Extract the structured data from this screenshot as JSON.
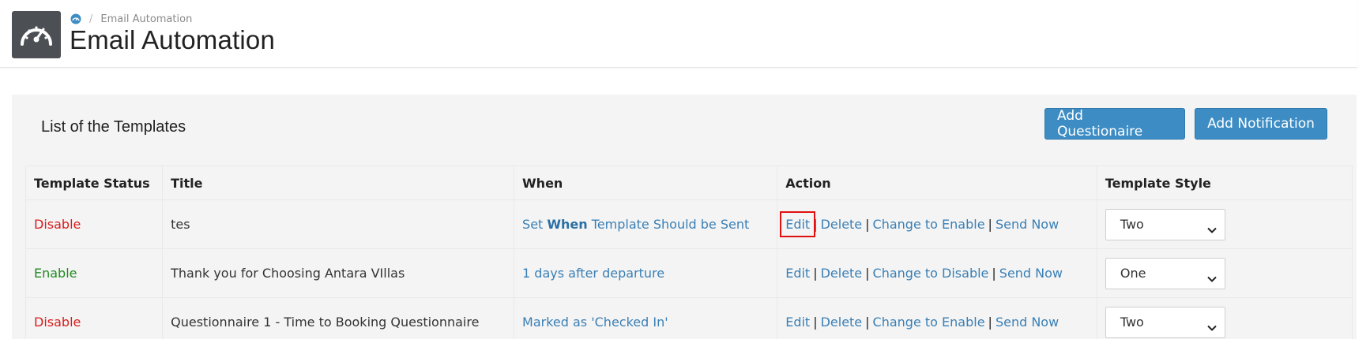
{
  "breadcrumb": {
    "current": "Email Automation",
    "separator": "/"
  },
  "page": {
    "title": "Email Automation"
  },
  "panel": {
    "title": "List of the Templates",
    "buttons": {
      "add_questionaire": "Add Questionaire",
      "add_notification": "Add Notification"
    }
  },
  "table": {
    "headers": {
      "status": "Template Status",
      "title": "Title",
      "when": "When",
      "action": "Action",
      "style": "Template Style"
    },
    "rows": [
      {
        "status": "Disable",
        "title": "tes",
        "when_prefix": "Set ",
        "when_bold": "When",
        "when_suffix": " Template Should be Sent",
        "action_edit": "Edit",
        "action_delete": "Delete",
        "action_toggle": "Change to Enable",
        "action_send": "Send Now",
        "style": "Two"
      },
      {
        "status": "Enable",
        "title": "Thank you for Choosing Antara VIllas",
        "when": "1 days after departure",
        "action_edit": "Edit",
        "action_delete": "Delete",
        "action_toggle": "Change to Disable",
        "action_send": "Send Now",
        "style": "One"
      },
      {
        "status": "Disable",
        "title": "Questionnaire 1 - Time to Booking Questionnaire",
        "when": "Marked as 'Checked In'",
        "action_edit": "Edit",
        "action_delete": "Delete",
        "action_toggle": "Change to Enable",
        "action_send": "Send Now",
        "style": "Two"
      }
    ],
    "pipe": "|"
  },
  "icons": {
    "header": "dashboard-gauge-icon",
    "breadcrumb_home": "dashboard-gauge-icon",
    "select_arrow": "chevron-down-icon"
  },
  "colors": {
    "primary": "#3d8dc4",
    "link": "#3a7fb5",
    "disable": "#d91c1c",
    "enable": "#1f8a1f",
    "header_icon_bg": "#4c4f54",
    "highlight": "#e01010"
  }
}
